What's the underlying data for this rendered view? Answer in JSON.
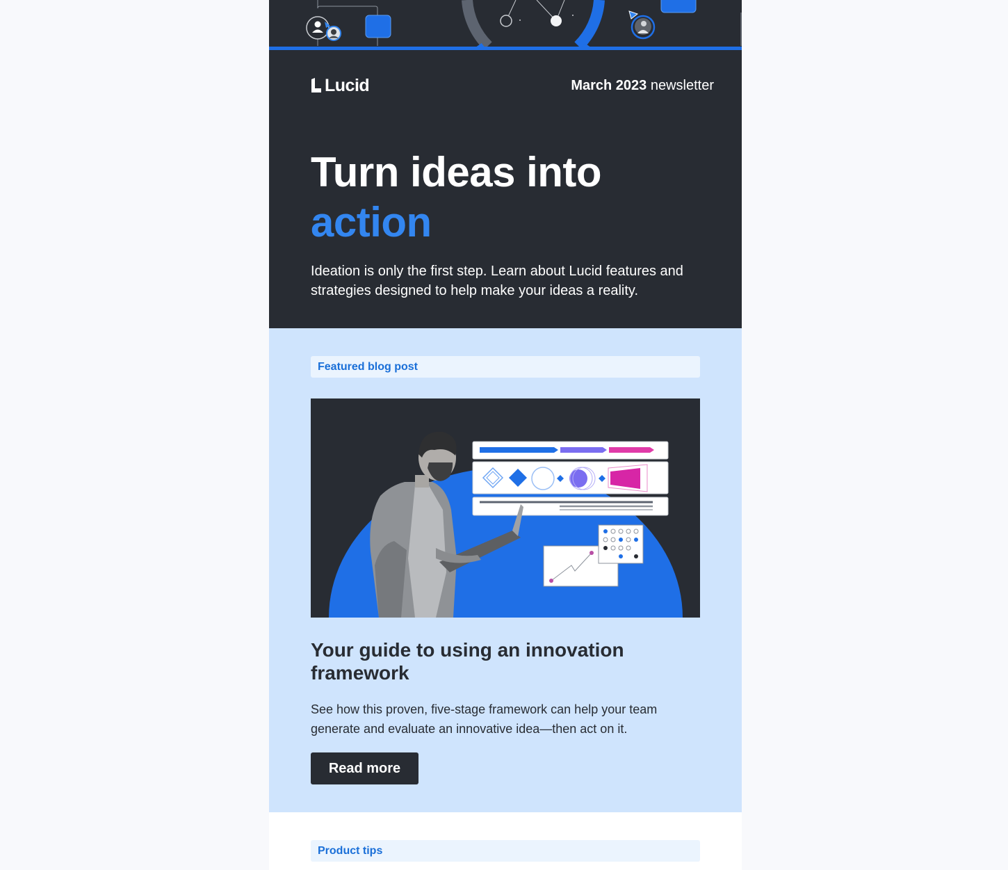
{
  "header": {
    "logo_text": "Lucid",
    "newsletter_month": "March 2023",
    "newsletter_word": "newsletter"
  },
  "hero": {
    "title_line1": "Turn ideas into",
    "title_accent": "action",
    "subtitle": "Ideation is only the first step. Learn about Lucid features and strategies designed to help make your ideas a reality."
  },
  "featured": {
    "tag": "Featured blog post",
    "post_title": "Your guide to using an innovation framework",
    "post_text": "See how this proven, five-stage framework can help your team generate and evaluate an innovative idea—then act on it.",
    "button_label": "Read more"
  },
  "tips": {
    "tag": "Product tips"
  },
  "colors": {
    "dark": "#282c33",
    "accent_blue": "#1f6fe6",
    "light_blue_section": "#cfe4fd",
    "tag_background": "#ebf4fe",
    "tag_text": "#1a6fd8",
    "page_background": "#f8f9fc"
  }
}
